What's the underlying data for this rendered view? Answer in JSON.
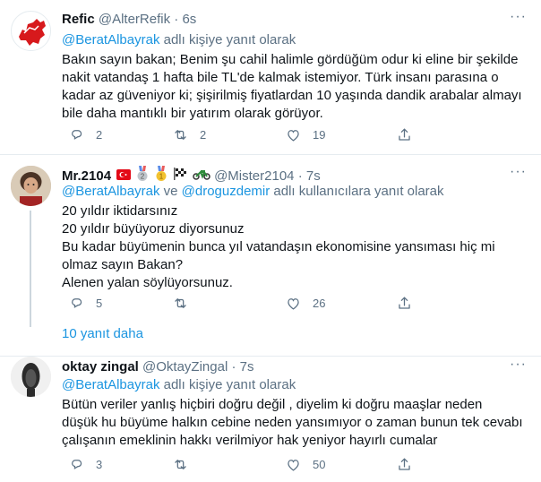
{
  "tweets": [
    {
      "name": "Refic",
      "handle": "@AlterRefik",
      "dot": "·",
      "time": "6s",
      "reply_prefix": "",
      "reply_mention_1": "@BeratAlbayrak",
      "reply_joiner": "",
      "reply_mention_2": "",
      "reply_suffix": " adlı kişiye yanıt olarak",
      "lines": [
        "Bakın sayın bakan; Benim şu cahil halimle gördüğüm odur ki eline bir şekilde",
        "nakit vatandaş 1 hafta bile TL'de kalmak istemiyor. Türk insanı parasına o",
        "kadar az güveniyor ki; şişirilmiş fiyatlardan 10 yaşında dandik arabalar almayı",
        "bile daha mantıklı bir yatırım olarak görüyor."
      ],
      "replies": "2",
      "retweets": "2",
      "likes": "19",
      "avatar_icon": "red-map-logo-icon"
    },
    {
      "name": "Mr.2104",
      "handle": "@Mister2104",
      "dot": "·",
      "time": "7s",
      "reply_mention_1": "@BeratAlbayrak",
      "reply_joiner": " ve ",
      "reply_mention_2": "@droguzdemir",
      "reply_suffix": " adlı kullanıcılara yanıt olarak",
      "lines": [
        "20 yıldır iktidarsınız",
        "20 yıldır büyüyoruz diyorsunuz",
        "Bu kadar büyümenin bunca yıl vatandaşın ekonomisine yansıması hiç mi",
        "olmaz sayın Bakan?",
        "Alenen yalan söylüyorsunuz."
      ],
      "replies": "5",
      "retweets": "",
      "likes": "26",
      "avatar_icon": "man-portrait-avatar"
    },
    {
      "name": "oktay zingal",
      "handle": "@OktayZingal",
      "dot": "·",
      "time": "7s",
      "reply_mention_1": "@BeratAlbayrak",
      "reply_joiner": "",
      "reply_mention_2": "",
      "reply_suffix": " adlı kişiye yanıt olarak",
      "lines": [
        "Bütün veriler yanlış hiçbiri doğru değil , diyelim ki doğru maaşlar neden",
        "düşük hu büyüme halkın cebine neden yansımıyor o zaman bunun tek cevabı",
        "çalışanın emeklinin hakkı verilmiyor hak yeniyor hayırlı cumalar"
      ],
      "replies": "3",
      "retweets": "",
      "likes": "50",
      "avatar_icon": "dark-face-avatar"
    }
  ],
  "more_replies_label": "10 yanıt daha",
  "colors": {
    "accent": "#1b95e0",
    "secondary_text": "#5b7083",
    "border": "#e6ecf0"
  }
}
